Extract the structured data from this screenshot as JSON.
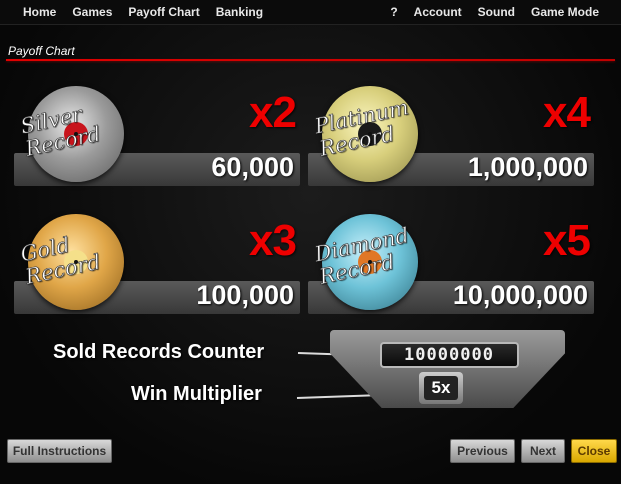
{
  "topbar": {
    "left_items": [
      "Home",
      "Games",
      "Payoff Chart",
      "Banking"
    ],
    "right_items": [
      "?",
      "Account",
      "Sound",
      "Game Mode"
    ]
  },
  "section": {
    "title": "Payoff Chart"
  },
  "tiles": [
    {
      "name": "Silver Record",
      "multiplier": "x2",
      "amount": "60,000",
      "icon": "silver-record-icon"
    },
    {
      "name": "Platinum Record",
      "multiplier": "x4",
      "amount": "1,000,000",
      "icon": "platinum-record-icon"
    },
    {
      "name": "Gold Record",
      "multiplier": "x3",
      "amount": "100,000",
      "icon": "gold-record-icon"
    },
    {
      "name": "Diamond Record",
      "multiplier": "x5",
      "amount": "10,000,000",
      "icon": "diamond-record-icon"
    }
  ],
  "counter": {
    "sold_label": "Sold Records Counter",
    "multiplier_label": "Win Multiplier",
    "digits": "10000000",
    "multiplier_value": "5x"
  },
  "buttons": {
    "instructions": "Full Instructions",
    "previous": "Previous",
    "next": "Next",
    "close": "Close"
  },
  "colors": {
    "accent_red": "#e00000",
    "close_yellow": "#f2c400"
  }
}
